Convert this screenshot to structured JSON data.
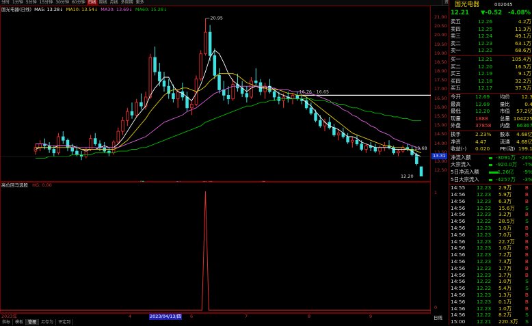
{
  "period_bar": {
    "items": [
      "分时",
      "1分钟",
      "5分钟",
      "15分钟",
      "30分钟",
      "60分钟",
      "日线",
      "周线",
      "月线",
      "多周期",
      "更多"
    ],
    "active": "日线",
    "right_tabs": [
      "资讯",
      "分时",
      "资金",
      "指标",
      "F10",
      "板块",
      "其他"
    ]
  },
  "legend": {
    "stock": "国光电器(日线)",
    "ma5": "MA5: 13.28↓",
    "ma10": "MA10: 13.54↓",
    "ma30": "MA30: 13.69↓",
    "ma60": "MA60: 15.28↓",
    "colors": {
      "ma5": "#ffffff",
      "ma10": "#e8d000",
      "ma30": "#e060e0",
      "ma60": "#00c000"
    }
  },
  "main_axis": {
    "ticks": [
      "21.00",
      "20.50",
      "20.00",
      "19.50",
      "19.00",
      "18.50",
      "18.00",
      "17.50",
      "17.00",
      "16.50",
      "16.00",
      "15.50",
      "15.00",
      "14.50",
      "14.00",
      "13.50",
      "13.00",
      "12.50"
    ],
    "crosshair_value": "13.31",
    "high_label": "20.95",
    "low_label": "12.20",
    "marker_label": "16.76 - 16.65",
    "current_label": "13.68"
  },
  "event_markers": [
    "跌",
    "财",
    "涨 榜",
    "增"
  ],
  "indicator": {
    "title": "高位回马选股",
    "value": "HG: 0.00",
    "ticks": [
      "1",
      "0"
    ]
  },
  "x_axis": {
    "labels": [
      "2023年",
      "4",
      "2023/04/13/四",
      "6",
      "7",
      "8",
      "9",
      "日线"
    ],
    "highlight": "2023/04/13/四"
  },
  "bottom_tabs": {
    "items": [
      "指标",
      "模板",
      "管理",
      "另存为",
      "评定到"
    ],
    "active": "管理"
  },
  "quote": {
    "name": "国光电器",
    "code": "002045",
    "price": "12.21",
    "change": "▼-0.52",
    "pct": "-4.08%",
    "sells": [
      {
        "label": "卖五",
        "price": "12.26",
        "vol": "4.2万"
      },
      {
        "label": "卖四",
        "price": "12.25",
        "vol": "11.3万"
      },
      {
        "label": "卖三",
        "price": "12.24",
        "vol": "49.1万"
      },
      {
        "label": "卖二",
        "price": "12.23",
        "vol": "63.1万"
      },
      {
        "label": "卖一",
        "price": "12.22",
        "vol": "68.6万"
      }
    ],
    "buys": [
      {
        "label": "买一",
        "price": "12.21",
        "vol": "105.4万"
      },
      {
        "label": "买二",
        "price": "12.20",
        "vol": "16.5万"
      },
      {
        "label": "买三",
        "price": "12.19",
        "vol": "9.1万"
      },
      {
        "label": "买四",
        "price": "12.18",
        "vol": "32.2万"
      },
      {
        "label": "买五",
        "price": "12.17",
        "vol": "37.5万"
      }
    ],
    "stats": [
      {
        "k1": "今开",
        "v1": "12.69",
        "k2": "均价",
        "v2": "12.3"
      },
      {
        "k1": "最高",
        "v1": "12.69",
        "k2": "量比",
        "v2": "0.4"
      },
      {
        "k1": "最低",
        "v1": "12.20",
        "k2": "市值",
        "v2": "57.2亿"
      },
      {
        "k1": "现量",
        "v1": "1888",
        "k2": "总量",
        "v2": "104225"
      },
      {
        "k1": "外盘",
        "v1": "37858",
        "k2": "内盘",
        "v2": "66367"
      }
    ],
    "stats2": [
      {
        "k1": "换手",
        "v1": "2.23%",
        "k2": "股本",
        "v2": "4.68亿"
      },
      {
        "k1": "净资",
        "v1": "4.47",
        "k2": "流通",
        "v2": "4.68亿"
      },
      {
        "k1": "收益(-)",
        "v1": "0.020",
        "k2": "PE(动)",
        "v2": "199.1"
      }
    ],
    "flows": [
      {
        "label": "净流入额",
        "v": "-3091万",
        "p": "-24%"
      },
      {
        "label": "大宗流入",
        "v": "-920.0万",
        "p": "-7%"
      },
      {
        "label": "5日净流入额",
        "v": "-1.26亿",
        "p": "-9%"
      },
      {
        "label": "5日大宗流入",
        "v": "-4257万",
        "p": "-3%"
      }
    ],
    "ticks_list": [
      {
        "t": "14:55",
        "p": "12.23",
        "v": "2.9万",
        "s": "B"
      },
      {
        "t": "14:56",
        "p": "12.23",
        "v": "5.9万",
        "s": "B"
      },
      {
        "t": "14:56",
        "p": "12.23",
        "v": "6.3万",
        "s": "B"
      },
      {
        "t": "14:56",
        "p": "12.22",
        "v": "15.6万",
        "s": "S"
      },
      {
        "t": "14:56",
        "p": "12.23",
        "v": "3.2万",
        "s": "B"
      },
      {
        "t": "14:56",
        "p": "12.22",
        "v": "28.5万",
        "s": "S"
      },
      {
        "t": "14:56",
        "p": "12.23",
        "v": "1.0万",
        "s": "B"
      },
      {
        "t": "14:56",
        "p": "12.23",
        "v": "7.0万",
        "s": "B"
      },
      {
        "t": "14:56",
        "p": "12.23",
        "v": "22.7万",
        "s": "B"
      },
      {
        "t": "14:56",
        "p": "12.23",
        "v": "1.0万",
        "s": "B"
      },
      {
        "t": "14:56",
        "p": "12.23",
        "v": "7.2万",
        "s": "B"
      },
      {
        "t": "14:56",
        "p": "12.23",
        "v": "7.3万",
        "s": "B"
      },
      {
        "t": "14:56",
        "p": "12.23",
        "v": "1.7万",
        "s": "B"
      },
      {
        "t": "14:56",
        "p": "12.23",
        "v": "3.7万",
        "s": "B"
      },
      {
        "t": "14:56",
        "p": "12.22",
        "v": "1.0万",
        "s": "S"
      },
      {
        "t": "14:56",
        "p": "12.22",
        "v": "5.4万",
        "s": "S"
      },
      {
        "t": "14:56",
        "p": "12.23",
        "v": "1.3万",
        "s": "B"
      },
      {
        "t": "14:56",
        "p": "12.23",
        "v": "0.1万",
        "s": "B"
      },
      {
        "t": "14:56",
        "p": "12.23",
        "v": "1.0万",
        "s": "B"
      },
      {
        "t": "14:56",
        "p": "12.22",
        "v": "8.2万",
        "s": "S"
      },
      {
        "t": "15:00",
        "p": "12.21",
        "v": "220.3万",
        "s": "S"
      }
    ]
  },
  "chart_data": {
    "type": "candlestick",
    "ylim": [
      12.2,
      21.0
    ],
    "ohlc": [
      [
        13.6,
        14.0,
        13.4,
        13.8
      ],
      [
        13.8,
        14.2,
        13.6,
        14.0
      ],
      [
        14.0,
        14.3,
        13.7,
        13.9
      ],
      [
        13.9,
        14.1,
        13.5,
        13.7
      ],
      [
        13.7,
        13.9,
        13.3,
        13.5
      ],
      [
        13.5,
        14.6,
        13.4,
        14.4
      ],
      [
        14.4,
        14.7,
        14.0,
        14.2
      ],
      [
        14.2,
        14.3,
        13.6,
        13.8
      ],
      [
        13.8,
        14.0,
        13.4,
        13.6
      ],
      [
        13.6,
        13.9,
        13.3,
        13.4
      ],
      [
        13.4,
        13.6,
        13.1,
        13.3
      ],
      [
        13.3,
        13.8,
        13.2,
        13.7
      ],
      [
        13.7,
        14.5,
        13.6,
        14.3
      ],
      [
        14.3,
        14.6,
        13.9,
        14.0
      ],
      [
        14.0,
        14.2,
        13.6,
        13.8
      ],
      [
        13.8,
        14.1,
        13.5,
        13.6
      ],
      [
        13.6,
        13.8,
        13.3,
        13.5
      ],
      [
        13.5,
        14.2,
        13.4,
        14.1
      ],
      [
        14.1,
        14.9,
        14.0,
        14.7
      ],
      [
        14.7,
        15.5,
        14.5,
        15.3
      ],
      [
        15.3,
        16.0,
        15.0,
        15.8
      ],
      [
        15.8,
        16.3,
        15.4,
        15.6
      ],
      [
        15.6,
        16.5,
        15.5,
        16.3
      ],
      [
        16.3,
        16.8,
        15.9,
        16.1
      ],
      [
        16.1,
        16.9,
        15.9,
        16.6
      ],
      [
        16.6,
        19.0,
        16.5,
        18.8
      ],
      [
        18.8,
        19.4,
        17.8,
        18.0
      ],
      [
        18.0,
        18.5,
        17.2,
        17.5
      ],
      [
        17.5,
        18.0,
        16.9,
        17.2
      ],
      [
        17.2,
        17.6,
        16.5,
        16.8
      ],
      [
        16.8,
        17.3,
        16.3,
        16.5
      ],
      [
        16.5,
        17.0,
        16.0,
        16.9
      ],
      [
        16.9,
        17.4,
        16.4,
        16.6
      ],
      [
        16.6,
        16.9,
        15.8,
        16.0
      ],
      [
        16.0,
        16.4,
        15.6,
        16.2
      ],
      [
        16.2,
        17.8,
        16.1,
        17.6
      ],
      [
        17.6,
        19.2,
        17.5,
        19.0
      ],
      [
        19.0,
        20.95,
        18.9,
        20.2
      ],
      [
        20.2,
        20.6,
        18.6,
        18.9
      ],
      [
        18.9,
        19.3,
        17.6,
        17.8
      ],
      [
        17.8,
        18.2,
        16.8,
        17.0
      ],
      [
        17.0,
        17.5,
        16.4,
        16.7
      ],
      [
        16.7,
        17.2,
        16.2,
        16.5
      ],
      [
        16.5,
        17.6,
        16.4,
        17.3
      ],
      [
        17.3,
        17.9,
        16.9,
        17.1
      ],
      [
        17.1,
        17.5,
        16.6,
        16.8
      ],
      [
        16.8,
        17.2,
        16.3,
        16.6
      ],
      [
        16.6,
        17.7,
        16.5,
        17.5
      ],
      [
        17.5,
        18.2,
        17.2,
        17.4
      ],
      [
        17.4,
        17.6,
        16.7,
        16.9
      ],
      [
        16.9,
        17.4,
        16.5,
        17.2
      ],
      [
        17.2,
        17.6,
        16.8,
        16.9
      ],
      [
        16.9,
        17.1,
        16.4,
        16.6
      ],
      [
        16.6,
        16.9,
        16.2,
        16.4
      ],
      [
        16.4,
        16.8,
        16.0,
        16.6
      ],
      [
        16.6,
        16.9,
        16.3,
        16.5
      ],
      [
        16.5,
        16.8,
        16.2,
        16.7
      ],
      [
        16.7,
        16.9,
        16.4,
        16.5
      ],
      [
        16.5,
        16.76,
        16.2,
        16.4
      ],
      [
        16.4,
        16.6,
        15.9,
        16.0
      ],
      [
        16.0,
        16.3,
        15.6,
        15.7
      ],
      [
        15.7,
        15.9,
        15.2,
        15.3
      ],
      [
        15.3,
        15.6,
        14.9,
        15.0
      ],
      [
        15.0,
        15.4,
        14.7,
        15.2
      ],
      [
        15.2,
        15.5,
        14.8,
        14.9
      ],
      [
        14.9,
        15.1,
        14.4,
        14.5
      ],
      [
        14.5,
        14.8,
        14.2,
        14.6
      ],
      [
        14.6,
        14.9,
        14.3,
        14.4
      ],
      [
        14.4,
        14.6,
        14.0,
        14.1
      ],
      [
        14.1,
        14.4,
        13.8,
        14.2
      ],
      [
        14.2,
        14.5,
        13.9,
        14.0
      ],
      [
        14.0,
        14.2,
        13.6,
        13.7
      ],
      [
        13.7,
        14.0,
        13.5,
        13.9
      ],
      [
        13.9,
        14.1,
        13.6,
        13.8
      ],
      [
        13.8,
        14.0,
        13.5,
        13.6
      ],
      [
        13.6,
        13.9,
        13.4,
        13.8
      ],
      [
        13.8,
        14.1,
        13.6,
        13.9
      ],
      [
        13.9,
        14.2,
        13.7,
        13.8
      ],
      [
        13.8,
        13.9,
        13.4,
        13.5
      ],
      [
        13.5,
        13.7,
        13.3,
        13.6
      ],
      [
        13.6,
        13.9,
        13.5,
        13.8
      ],
      [
        13.8,
        14.0,
        13.6,
        13.7
      ],
      [
        13.7,
        13.9,
        13.3,
        13.4
      ],
      [
        13.4,
        13.5,
        12.8,
        12.9
      ],
      [
        12.73,
        12.75,
        12.2,
        12.21
      ]
    ],
    "ma": {
      "ma5": [
        13.7,
        13.8,
        13.8,
        13.8,
        13.8,
        13.9,
        13.9,
        13.9,
        13.9,
        13.8,
        13.7,
        13.6,
        13.7,
        13.7,
        13.8,
        13.9,
        13.8,
        13.8,
        14.0,
        14.3,
        14.7,
        15.1,
        15.5,
        15.8,
        16.1,
        16.7,
        17.1,
        17.4,
        17.7,
        17.7,
        17.2,
        16.9,
        16.8,
        16.6,
        16.4,
        16.8,
        17.3,
        18.0,
        18.8,
        19.2,
        19.0,
        18.5,
        17.9,
        17.5,
        17.3,
        17.1,
        16.9,
        17.1,
        17.2,
        17.1,
        17.1,
        17.2,
        17.0,
        16.8,
        16.7,
        16.6,
        16.5,
        16.5,
        16.5,
        16.3,
        16.1,
        15.8,
        15.5,
        15.2,
        15.0,
        14.9,
        14.8,
        14.6,
        14.4,
        14.4,
        14.3,
        14.1,
        14.0,
        13.9,
        13.8,
        13.8,
        13.8,
        13.8,
        13.7,
        13.7,
        13.7,
        13.7,
        13.6,
        13.4,
        13.3
      ],
      "ma10": [
        13.8,
        13.8,
        13.8,
        13.8,
        13.8,
        13.8,
        13.8,
        13.8,
        13.8,
        13.8,
        13.7,
        13.7,
        13.7,
        13.7,
        13.7,
        13.7,
        13.7,
        13.7,
        13.8,
        14.0,
        14.2,
        14.5,
        14.8,
        15.1,
        15.4,
        15.8,
        16.1,
        16.4,
        16.7,
        16.9,
        17.0,
        17.0,
        17.1,
        17.1,
        17.0,
        16.9,
        17.0,
        17.2,
        17.5,
        17.7,
        17.9,
        17.9,
        17.9,
        17.9,
        17.8,
        17.6,
        17.4,
        17.3,
        17.2,
        17.2,
        17.1,
        17.0,
        17.0,
        17.0,
        16.9,
        16.8,
        16.8,
        16.7,
        16.7,
        16.6,
        16.4,
        16.2,
        16.0,
        15.8,
        15.6,
        15.4,
        15.2,
        15.0,
        14.8,
        14.6,
        14.5,
        14.4,
        14.3,
        14.2,
        14.1,
        14.0,
        13.9,
        13.9,
        13.8,
        13.8,
        13.8,
        13.7,
        13.7,
        13.6,
        13.5
      ],
      "ma30": [
        14.0,
        14.0,
        14.0,
        13.9,
        13.9,
        13.9,
        13.9,
        13.9,
        13.8,
        13.8,
        13.8,
        13.8,
        13.8,
        13.8,
        13.8,
        13.8,
        13.8,
        13.8,
        13.8,
        13.9,
        14.0,
        14.1,
        14.2,
        14.3,
        14.4,
        14.6,
        14.8,
        15.0,
        15.2,
        15.3,
        15.4,
        15.5,
        15.6,
        15.8,
        15.9,
        16.0,
        16.2,
        16.4,
        16.6,
        16.8,
        16.9,
        17.0,
        17.1,
        17.2,
        17.2,
        17.2,
        17.2,
        17.2,
        17.2,
        17.2,
        17.2,
        17.1,
        17.1,
        17.0,
        17.0,
        17.0,
        16.9,
        16.9,
        16.9,
        16.8,
        16.8,
        16.7,
        16.6,
        16.5,
        16.4,
        16.2,
        16.1,
        15.9,
        15.8,
        15.6,
        15.5,
        15.3,
        15.2,
        15.0,
        14.9,
        14.7,
        14.6,
        14.5,
        14.3,
        14.2,
        14.1,
        14.0,
        13.9,
        13.8,
        13.7
      ],
      "ma60": [
        13.2,
        13.2,
        13.2,
        13.3,
        13.3,
        13.3,
        13.3,
        13.3,
        13.4,
        13.4,
        13.4,
        13.4,
        13.4,
        13.5,
        13.5,
        13.5,
        13.5,
        13.5,
        13.6,
        13.6,
        13.6,
        13.7,
        13.7,
        13.8,
        13.8,
        13.9,
        14.0,
        14.1,
        14.2,
        14.3,
        14.4,
        14.5,
        14.6,
        14.7,
        14.8,
        14.9,
        15.0,
        15.2,
        15.3,
        15.4,
        15.5,
        15.6,
        15.7,
        15.8,
        15.9,
        16.0,
        16.1,
        16.1,
        16.2,
        16.3,
        16.3,
        16.4,
        16.4,
        16.5,
        16.5,
        16.5,
        16.5,
        16.5,
        16.5,
        16.5,
        16.5,
        16.4,
        16.4,
        16.4,
        16.3,
        16.3,
        16.2,
        16.2,
        16.1,
        16.0,
        16.0,
        15.9,
        15.8,
        15.8,
        15.7,
        15.7,
        15.6,
        15.6,
        15.5,
        15.5,
        15.4,
        15.4,
        15.3,
        15.3,
        15.3
      ]
    },
    "indicator_values": {
      "spike_index": 37,
      "spike_value": 1
    }
  }
}
